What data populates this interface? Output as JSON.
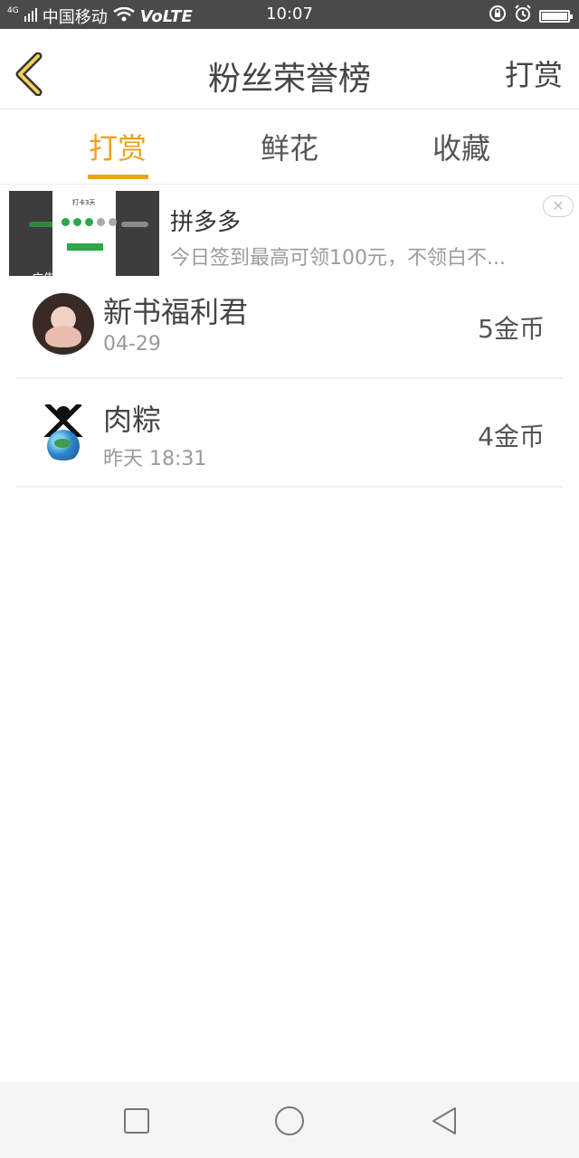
{
  "status_bar": {
    "network_type": "4G",
    "carrier": "中国移动",
    "volte": "VoLTE",
    "time": "10:07"
  },
  "header": {
    "title": "粉丝荣誉榜",
    "action_label": "打赏",
    "back_icon": "chevron-left-icon"
  },
  "tabs": [
    {
      "label": "打赏",
      "active": true
    },
    {
      "label": "鲜花",
      "active": false
    },
    {
      "label": "收藏",
      "active": false
    }
  ],
  "ad": {
    "label": "广告",
    "name": "拼多多",
    "description": "今日签到最高可领100元，不领白不...",
    "thumb_title": "打卡3天"
  },
  "list": [
    {
      "name": "新书福利君",
      "time": "04-29",
      "coins": "5金币"
    },
    {
      "name": "肉粽",
      "time": "昨天 18:31",
      "coins": "4金币"
    }
  ],
  "colors": {
    "accent": "#f0a01e",
    "status_bar": "#4a4a4a",
    "text_primary": "#444444",
    "text_secondary": "#9a9a9a"
  }
}
